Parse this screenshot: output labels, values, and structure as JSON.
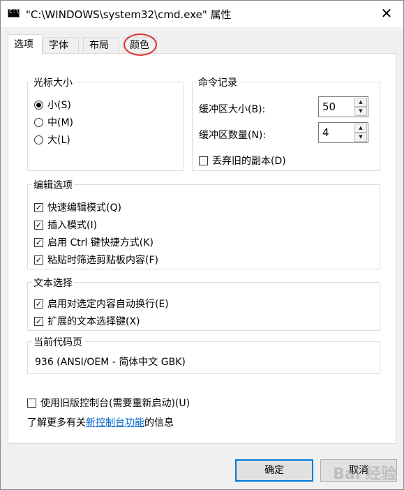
{
  "window": {
    "title": "\"C:\\WINDOWS\\system32\\cmd.exe\" 属性",
    "icon_text": "C:\\.",
    "close_glyph": "✕"
  },
  "tabs": [
    {
      "label": "选项",
      "active": true
    },
    {
      "label": "字体",
      "active": false
    },
    {
      "label": "布局",
      "active": false
    },
    {
      "label": "颜色",
      "active": false
    }
  ],
  "cursor_size": {
    "title": "光标大小",
    "options": [
      {
        "label": "小(S)",
        "checked": true
      },
      {
        "label": "中(M)",
        "checked": false
      },
      {
        "label": "大(L)",
        "checked": false
      }
    ]
  },
  "history": {
    "title": "命令记录",
    "buffer_size_label": "缓冲区大小(B):",
    "buffer_size_value": "50",
    "buffer_count_label": "缓冲区数量(N):",
    "buffer_count_value": "4",
    "discard_label": "丢弃旧的副本(D)",
    "discard_checked": false
  },
  "edit_options": {
    "title": "编辑选项",
    "items": [
      {
        "label": "快速编辑模式(Q)",
        "checked": true
      },
      {
        "label": "插入模式(I)",
        "checked": true
      },
      {
        "label": "启用 Ctrl 键快捷方式(K)",
        "checked": true
      },
      {
        "label": "粘贴时筛选剪贴板内容(F)",
        "checked": true
      }
    ]
  },
  "text_selection": {
    "title": "文本选择",
    "items": [
      {
        "label": "启用对选定内容自动换行(E)",
        "checked": true
      },
      {
        "label": "扩展的文本选择键(X)",
        "checked": true
      }
    ]
  },
  "code_page": {
    "title": "当前代码页",
    "value": "936   (ANSI/OEM - 简体中文 GBK)"
  },
  "legacy": {
    "label": "使用旧版控制台(需要重新启动)(U)",
    "checked": false
  },
  "info": {
    "prefix": "了解更多有关",
    "link": "新控制台功能",
    "suffix": "的信息"
  },
  "buttons": {
    "ok": "确定",
    "cancel": "取消"
  },
  "check_glyph": "✓",
  "watermark_text": "Bai 经验"
}
